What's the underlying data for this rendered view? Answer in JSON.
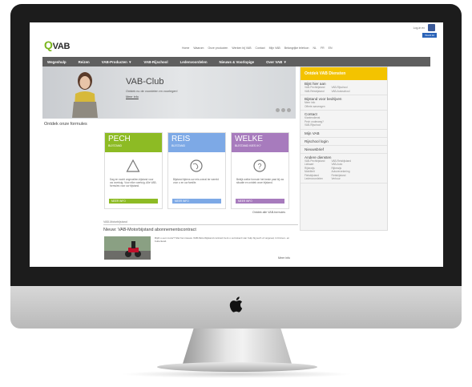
{
  "header": {
    "top_link": "Log-in ex",
    "nl_badge": "Wordt lid",
    "logo": "VAB",
    "top_links": [
      "Home",
      "Waarom",
      "Onze producten",
      "Werken bij VAB",
      "Contact",
      "Mijn VAB",
      "Belangrijke telefoon",
      "NL",
      "FR",
      "EN"
    ]
  },
  "nav": [
    "Wegenhulp",
    "Reizen",
    "VAB-Producten ▼",
    "VAB-Rijschool",
    "Ledenvoordelen",
    "Nieuws & Voorlopige",
    "Over VAB ▼"
  ],
  "hero": {
    "title": "VAB-Club",
    "subtitle": "Ontdek nu de voordelen en voorlegen!",
    "more": "Meer info"
  },
  "sidebar": {
    "head": "Ontdek VAB Diensten",
    "sections": [
      {
        "title": "Bijst hier aan",
        "items": [
          "VAB-Pechbijstand",
          "VAB-Reisbijstand",
          "VAB-Rijschool",
          "VAB-Autoschool"
        ]
      },
      {
        "title": "Bijstand voor bedrijven",
        "items": [
          "Meer info",
          "Offerte aanvragen"
        ]
      },
      {
        "title": "Contact",
        "items": [
          "Klantendienst",
          "Pech onderweg?",
          "VAB-Rijschool"
        ]
      },
      {
        "title": "Mijn VAB",
        "items": []
      },
      {
        "title": "Rijschool login",
        "items": []
      },
      {
        "title": "Nieuwsbrief",
        "items": []
      },
      {
        "title": "Andere diensten",
        "items": [
          "VAB-Pechbijstand",
          "VAB-Reisbijstand",
          "Lidkaart",
          "VAB-Auto",
          "Rijbewijs",
          "Rijbewijs",
          "Mobiliteit",
          "Autoverzekering",
          "Fietsbijstand",
          "Fietsbijstand",
          "Ledenvoordelen",
          "Verhuur"
        ]
      }
    ]
  },
  "section_title": "Ontdek onze formules",
  "cards": [
    {
      "title": "PECH",
      "sub": "BIJSTAND",
      "body": "Dag en nacht ongevallen-bijstand voor uw voertuig. Voor elke voertuig. Alle VAB-formules voor uw bijstand.",
      "button": "MEER INFO"
    },
    {
      "title": "REIS",
      "sub": "BIJSTAND",
      "body": "Bijstand tijdens uw reis overal ter wereld voor u en uw familie.",
      "button": "MEER INFO"
    },
    {
      "title": "WELKE",
      "sub": "BIJSTAND KIES IK?",
      "body": "Bekijk welke formule het beste past bij uw situatie en ontdek onze bijstand.",
      "button": "MEER INFO"
    }
  ],
  "more_link": "Ontdek alle VAB-formules",
  "news": {
    "label": "VAB-Motorbijstand",
    "title": "Nieuw: VAB-Motorbijstand abonnementscontract",
    "text": "Rijdt u een motor? Met het nieuwe VAB-Motorbijstand contract bent u verzekerd van hulp bij pech of ongeval, in binnen- en buitenland.",
    "more": "Meer info"
  }
}
